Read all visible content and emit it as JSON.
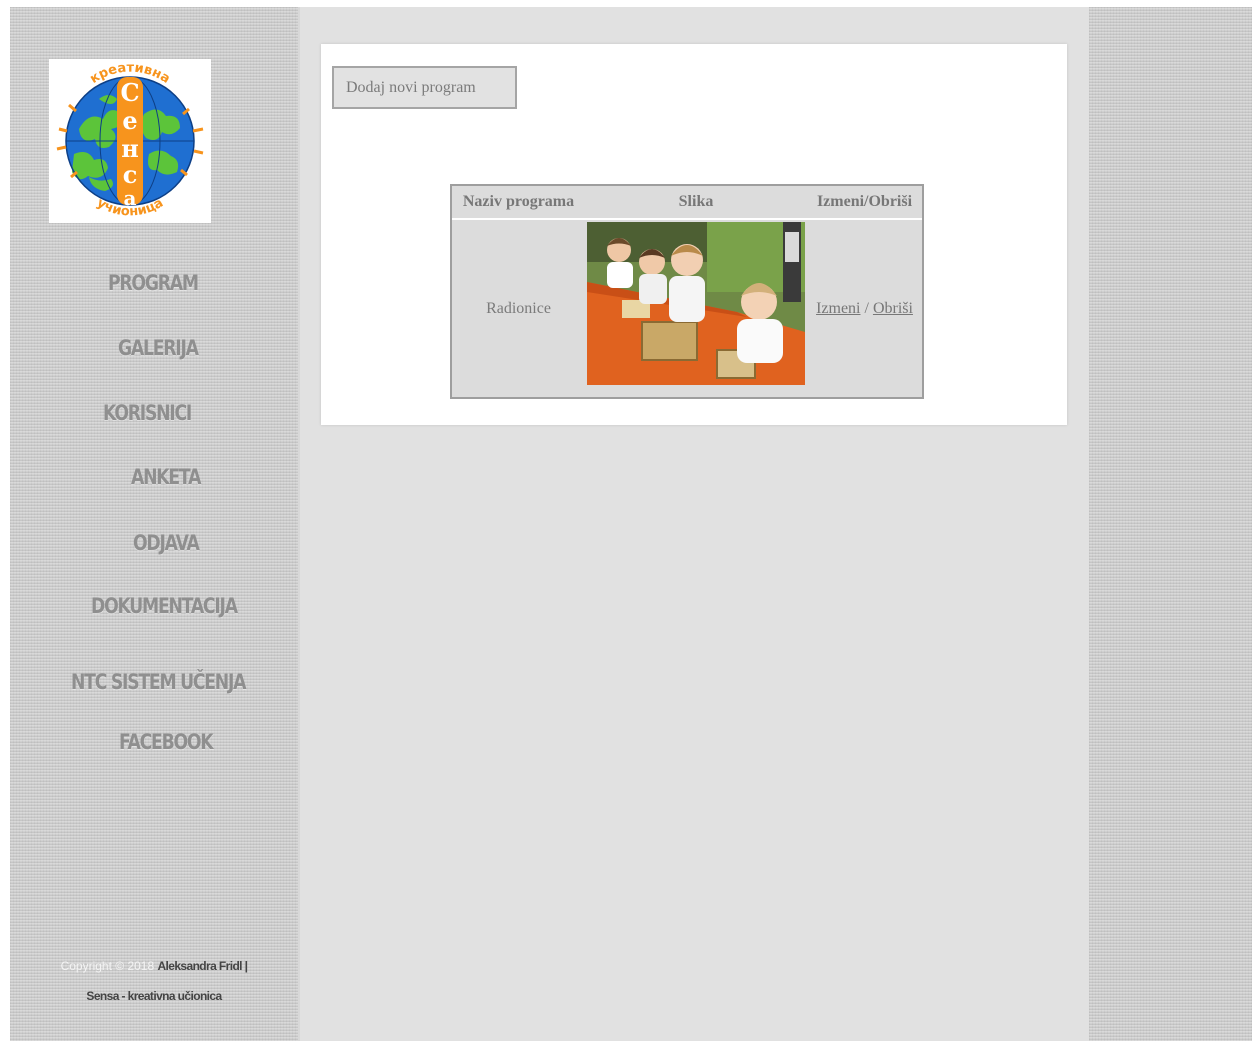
{
  "sidebar": {
    "logo_alt": "Kreativna Sensa učionica",
    "nav": [
      {
        "label": "PROGRAM"
      },
      {
        "label": "GALERIJA"
      },
      {
        "label": "KORISNICI"
      },
      {
        "label": "ANKETA"
      },
      {
        "label": "ODJAVA"
      },
      {
        "label": "DOKUMENTACIJA"
      },
      {
        "label": "NTC SISTEM UČENJA"
      },
      {
        "label": "FACEBOOK"
      }
    ],
    "footer": {
      "copyright": "Copyright © 2018",
      "author": "Aleksandra Fridl |",
      "site": "Sensa - kreativna učionica"
    }
  },
  "main": {
    "add_button": "Dodaj novi program",
    "table": {
      "headers": [
        "Naziv programa",
        "Slika",
        "Izmeni/Obriši"
      ],
      "rows": [
        {
          "name": "Radionice",
          "edit": "Izmeni",
          "separator": "/",
          "delete": "Obriši"
        }
      ]
    }
  },
  "colors": {
    "sidebar_texture": "#cfcfcf",
    "main_background": "#e1e1e1",
    "nav_text": "#8f8f8f",
    "logo_orange": "#f7941d",
    "logo_blue": "#1f6fd1",
    "logo_green": "#5cc43a"
  }
}
